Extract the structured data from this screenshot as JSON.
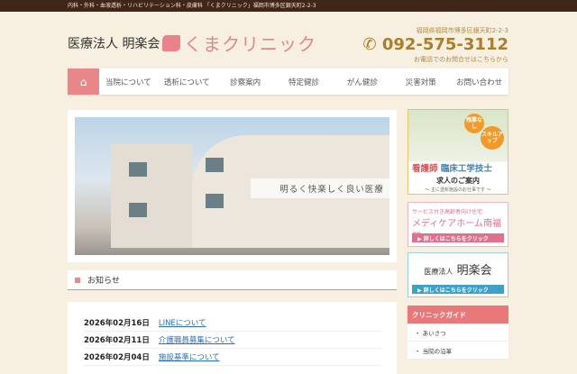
{
  "topbar": "内科・外科・血液透析・リハビリテーション科・皮膚科 「くまクリニック」福岡市博多区銀天町2-2-3",
  "header": {
    "corp": "医療法人 明楽会",
    "clinic": "くまクリニック",
    "address": "福岡県福岡市博多区銀天町2-2-3",
    "tel": "092-575-3112",
    "tel_note": "お電話でのお問合せはこちらから"
  },
  "nav": {
    "home_icon": "home-icon",
    "items": [
      {
        "label": "当院について"
      },
      {
        "label": "透析について"
      },
      {
        "label": "診察案内"
      },
      {
        "label": "特定健診"
      },
      {
        "label": "がん健診"
      },
      {
        "label": "災害対策"
      },
      {
        "label": "お問い合わせ"
      }
    ]
  },
  "hero": {
    "caption": "明るく快楽しく良い医療"
  },
  "news": {
    "title": "お知らせ",
    "items": [
      {
        "date": "2026年02月16日",
        "title": "LINEについて"
      },
      {
        "date": "2026年02月11日",
        "title": "介護職員募集について"
      },
      {
        "date": "2026年02月04日",
        "title": "施設基準について"
      }
    ]
  },
  "sidebar": {
    "recruit": {
      "badge1": "残業なし",
      "badge2": "スキルアップ",
      "jobs1": "看護師",
      "jobs2": "臨床工学技士",
      "title": "求人のご案内",
      "sub": "～ 主に透析施設のお仕事です ～"
    },
    "care": {
      "sub": "サービス付き高齢者向け住宅",
      "title": "メディケアホーム南福岡",
      "button": "▶ 詳しくはこちらをクリック"
    },
    "corp": {
      "small": "医療法人",
      "big": "明楽会",
      "button": "▶ 詳しくはこちらをクリック"
    },
    "guide": {
      "title": "クリニックガイド",
      "items": [
        "・ あいさつ",
        "・ 当院の沿革"
      ]
    }
  },
  "colors": {
    "accent": "#e9868a",
    "brown": "#3f2618",
    "gold": "#a87f2c"
  }
}
